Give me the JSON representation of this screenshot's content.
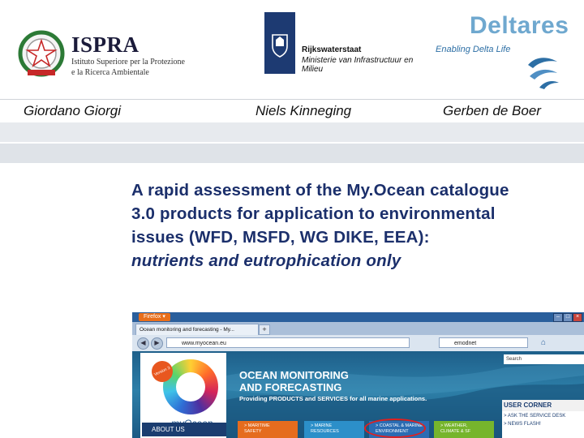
{
  "logos": {
    "ispra": {
      "title": "ISPRA",
      "sub_line1": "Istituto Superiore per la Protezione",
      "sub_line2": "e la Ricerca Ambientale"
    },
    "rws": {
      "name": "Rijkswaterstaat",
      "ministry": "Ministerie van Infrastructuur en Milieu"
    },
    "deltares": {
      "name": "Deltares",
      "tagline": "Enabling Delta Life"
    }
  },
  "authors": [
    "Giordano Giorgi",
    "Niels Kinneging",
    "Gerben de Boer"
  ],
  "title": {
    "line1": "A rapid assessment of the My.Ocean catalogue",
    "line2": "3.0 products for application to environmental",
    "line3": "issues (WFD, MSFD, WG DIKE, EEA):",
    "line4": "nutrients and eutrophication only"
  },
  "browser": {
    "firefox_label": "Firefox ▾",
    "tab_title": "Ocean monitoring and forecasting - My...",
    "new_tab": "+",
    "url": "www.myocean.eu",
    "search": "emodnet",
    "site": {
      "title1": "OCEAN MONITORING",
      "title2": "AND FORECASTING",
      "tagline": "Providing PRODUCTS and SERVICES for all marine applications.",
      "search_label": "Search",
      "badge": "Version 3",
      "logo": "myOcean",
      "about": "ABOUT US",
      "user_corner": "USER CORNER",
      "links": [
        "> ASK THE SERVICE DESK",
        "> NEWS FLASH!"
      ],
      "tiles": [
        [
          "> MARITIME",
          "SAFETY"
        ],
        [
          "> MARINE",
          "RESOURCES"
        ],
        [
          "> COASTAL & MARINE",
          "ENVIRONMENT"
        ],
        [
          "> WEATHER,",
          "CLIMATE & SF"
        ]
      ]
    }
  },
  "colors": {
    "title": "#1b2f6b",
    "grey_band": "#e7eaee",
    "site_blue": "#2d7fa8",
    "highlight_ring": "#e02020"
  }
}
